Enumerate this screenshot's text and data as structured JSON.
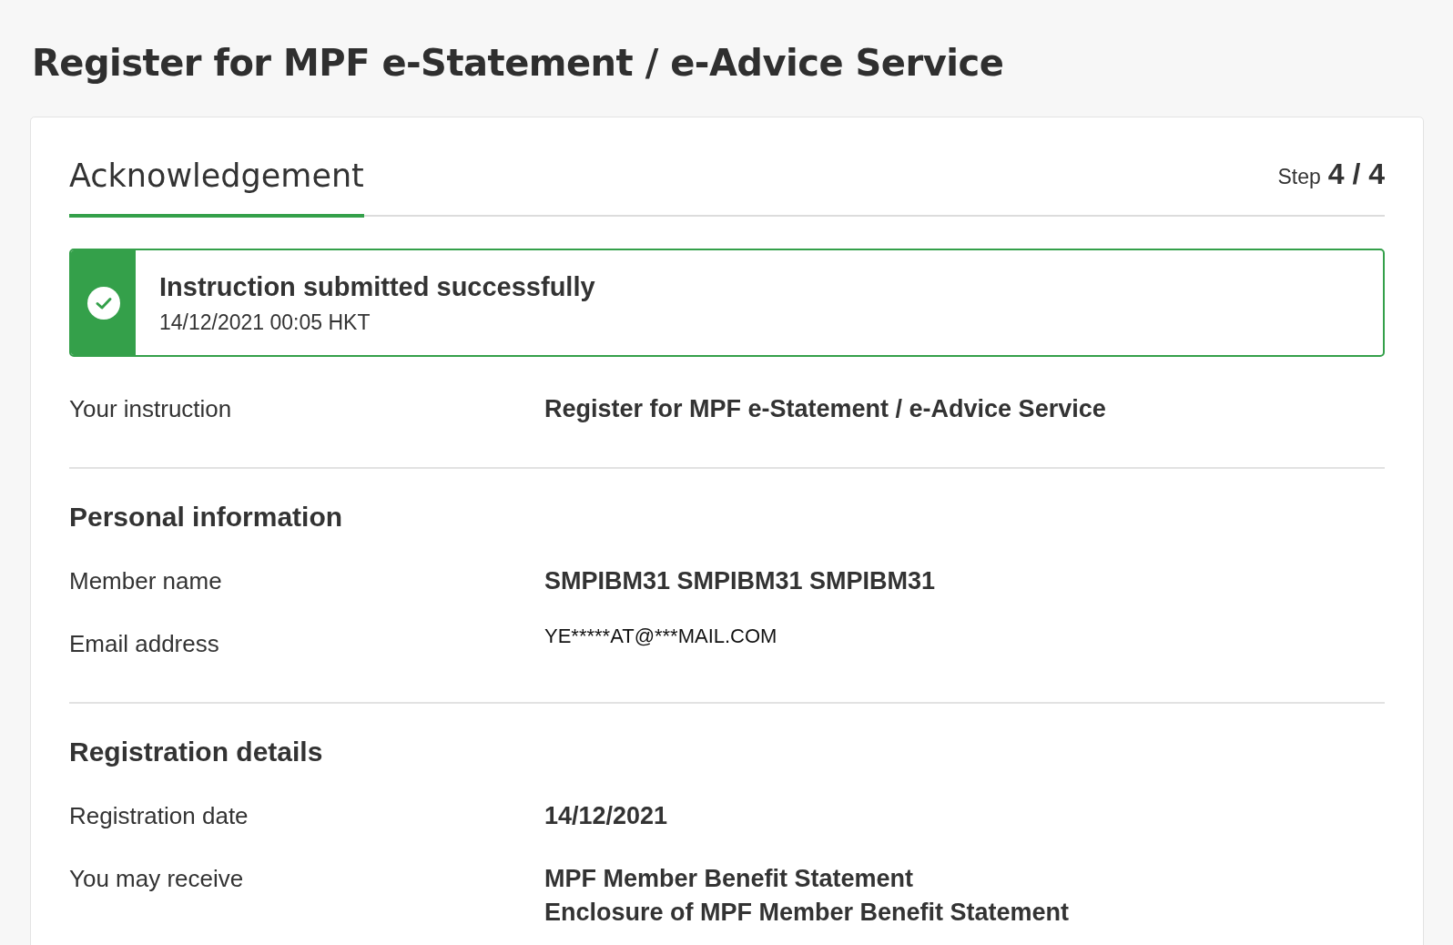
{
  "page_title": "Register for MPF e-Statement / e-Advice Service",
  "card": {
    "heading": "Acknowledgement",
    "step_label": "Step",
    "step_value": "4 / 4",
    "banner": {
      "title": "Instruction submitted successfully",
      "timestamp": "14/12/2021 00:05 HKT"
    },
    "sections": [
      {
        "rows": [
          {
            "kind": "text",
            "label": "Your instruction",
            "values": [
              "Register for MPF e-Statement / e-Advice Service"
            ]
          }
        ]
      },
      {
        "heading": "Personal information",
        "rows": [
          {
            "kind": "text",
            "label": "Member name",
            "values": [
              "SMPIBM31 SMPIBM31 SMPIBM31"
            ]
          },
          {
            "kind": "masked",
            "label": "Email address",
            "values": [
              "YE*****AT@***MAIL.COM"
            ]
          }
        ]
      },
      {
        "heading": "Registration details",
        "rows": [
          {
            "kind": "text",
            "label": "Registration date",
            "values": [
              "14/12/2021"
            ]
          },
          {
            "kind": "text",
            "label": "You may receive",
            "values": [
              "MPF Member Benefit Statement",
              "Enclosure of MPF Member Benefit Statement"
            ]
          }
        ]
      }
    ]
  }
}
